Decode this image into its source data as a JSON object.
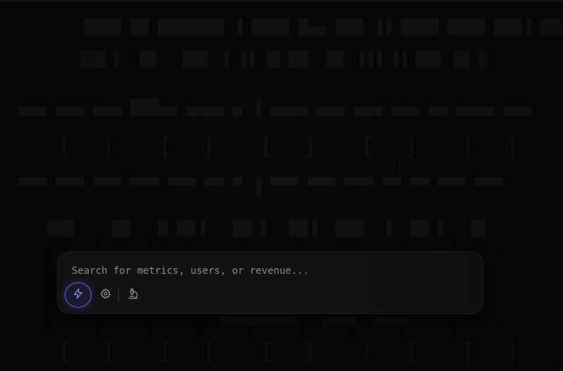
{
  "search": {
    "placeholder": "Search for metrics, users, or revenue..."
  },
  "toolbar": {
    "buttons": [
      {
        "icon": "bolt-icon",
        "active": true
      },
      {
        "icon": "gear-icon",
        "active": false
      },
      {
        "icon": "microscope-icon",
        "active": false
      }
    ],
    "accent_color": "#6c5ce7"
  },
  "background": {
    "rows": [
      "         ████ ██ ███████ ▐ ████ █▄▄ ███ ▐▐ ████ ████ ███▐ ██▄█",
      "         ▐██▌▐  ▐█▌  ▐██▌ ▐ ▐▐ ▐█ ██▌ ▐█▌ ▐▐▐ ▐▐ ███ ▐█▌▐▌",
      "  ▄▄▄ ▄▄▄ ▄▄▄ ███▄▄ ▄▄▄▄ ▄ ▐ ▄▄▄▄ ▄▄▄ ▄▄▄ ▄▄▄ ▄▄ ▄▄▄▄ ▄▄▄",
      "    [  ]   [  ]   [  ]   [  ]   [  ]   [  ]",
      "  ▀▀▀ ▀▀▀ ▀▀▀ ▀▀▀ ▀▀▀ ▀▀ ▀ ▐ ▀▀▀ ▀▀▀ ▀▀▀ ▀▀ ▀▀ ▀▀▀ ▀▀▀",
      "     ███    ██   █ ██▐   ██ ▌  ██▐  ███  ▐  ██ ▌  ▐█",
      "                          ▀▀▀▀▀▀▀▀▀   ▀▀▀▀  ▀▀▀▀",
      "    [  ]   [  ]   [  ]   [  ]   [  ]   [  ]"
    ]
  }
}
